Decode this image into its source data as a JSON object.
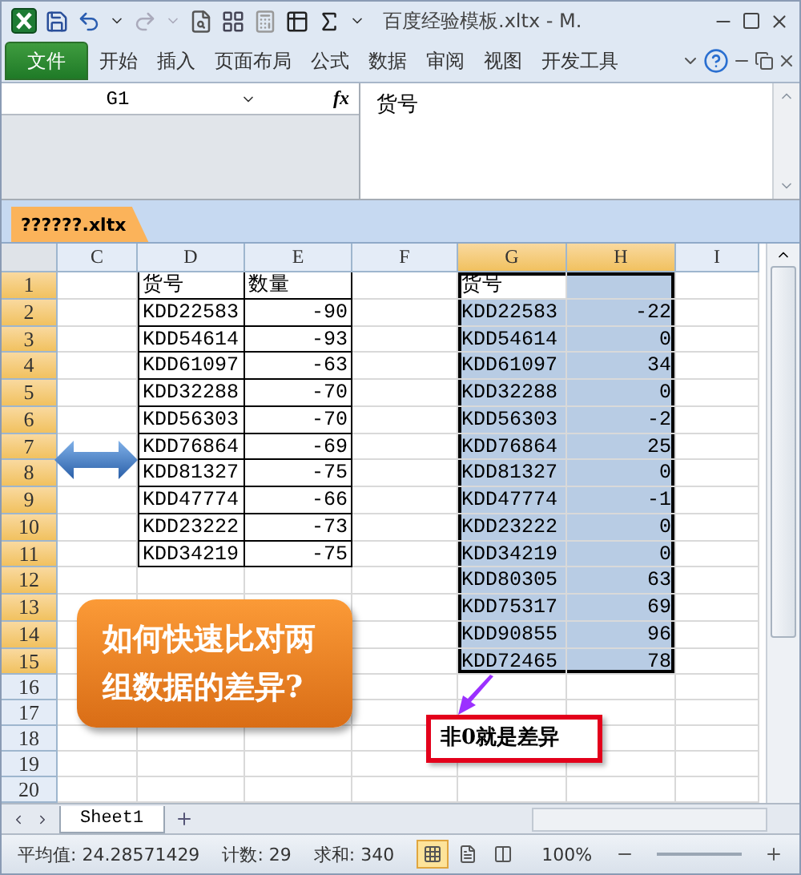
{
  "window": {
    "title": "百度经验模板.xltx - M."
  },
  "ribbon_tabs": [
    {
      "label": "文件",
      "kind": "file"
    },
    {
      "label": "开始",
      "kind": "tab"
    },
    {
      "label": "插入",
      "kind": "tab"
    },
    {
      "label": "页面布局",
      "kind": "tab"
    },
    {
      "label": "公式",
      "kind": "tab"
    },
    {
      "label": "数据",
      "kind": "tab"
    },
    {
      "label": "审阅",
      "kind": "tab"
    },
    {
      "label": "视图",
      "kind": "tab"
    },
    {
      "label": "开发工具",
      "kind": "tab"
    }
  ],
  "name_box": {
    "value": "G1",
    "function_button": "fx"
  },
  "formula_bar": {
    "value": "货号"
  },
  "workbook_tab": {
    "label": "??????.xltx"
  },
  "column_headers": [
    {
      "label": "C",
      "selected": false
    },
    {
      "label": "D",
      "selected": false
    },
    {
      "label": "E",
      "selected": false
    },
    {
      "label": "F",
      "selected": false
    },
    {
      "label": "G",
      "selected": true
    },
    {
      "label": "H",
      "selected": true
    },
    {
      "label": "I",
      "selected": false
    }
  ],
  "row_headers": [
    {
      "label": "1",
      "selected": true
    },
    {
      "label": "2",
      "selected": true
    },
    {
      "label": "3",
      "selected": true
    },
    {
      "label": "4",
      "selected": true
    },
    {
      "label": "5",
      "selected": true
    },
    {
      "label": "6",
      "selected": true
    },
    {
      "label": "7",
      "selected": true
    },
    {
      "label": "8",
      "selected": true
    },
    {
      "label": "9",
      "selected": true
    },
    {
      "label": "10",
      "selected": true
    },
    {
      "label": "11",
      "selected": true
    },
    {
      "label": "12",
      "selected": true
    },
    {
      "label": "13",
      "selected": true
    },
    {
      "label": "14",
      "selected": true
    },
    {
      "label": "15",
      "selected": true
    },
    {
      "label": "16",
      "selected": false
    },
    {
      "label": "17",
      "selected": false
    },
    {
      "label": "18",
      "selected": false
    },
    {
      "label": "19",
      "selected": false
    },
    {
      "label": "20",
      "selected": false
    }
  ],
  "table_1": {
    "header": [
      "货号",
      "数量"
    ],
    "rows": [
      [
        "KDD22583",
        "-90"
      ],
      [
        "KDD54614",
        "-93"
      ],
      [
        "KDD61097",
        "-63"
      ],
      [
        "KDD32288",
        "-70"
      ],
      [
        "KDD56303",
        "-70"
      ],
      [
        "KDD76864",
        "-69"
      ],
      [
        "KDD81327",
        "-75"
      ],
      [
        "KDD47774",
        "-66"
      ],
      [
        "KDD23222",
        "-73"
      ],
      [
        "KDD34219",
        "-75"
      ]
    ]
  },
  "table_2": {
    "selected": true,
    "header": [
      "货号"
    ],
    "rows": [
      [
        "KDD22583",
        "-22"
      ],
      [
        "KDD54614",
        "0"
      ],
      [
        "KDD61097",
        "34"
      ],
      [
        "KDD32288",
        "0"
      ],
      [
        "KDD56303",
        "-2"
      ],
      [
        "KDD76864",
        "25"
      ],
      [
        "KDD81327",
        "0"
      ],
      [
        "KDD47774",
        "-1"
      ],
      [
        "KDD23222",
        "0"
      ],
      [
        "KDD34219",
        "0"
      ],
      [
        "KDD80305",
        "63"
      ],
      [
        "KDD75317",
        "69"
      ],
      [
        "KDD90855",
        "96"
      ],
      [
        "KDD72465",
        "78"
      ]
    ]
  },
  "callout": {
    "text": "如何快速比对两组数据的差异?"
  },
  "note": {
    "text": "非0就是差异"
  },
  "sheet_tabs": [
    {
      "label": "Sheet1",
      "selected": true
    }
  ],
  "status_bar": {
    "average": "平均值: 24.28571429",
    "count": "计数: 29",
    "sum": "求和: 340",
    "zoom": "100%",
    "views": [
      {
        "kind": "normal",
        "selected": true
      },
      {
        "kind": "layout",
        "selected": false
      },
      {
        "kind": "break",
        "selected": false
      }
    ]
  }
}
